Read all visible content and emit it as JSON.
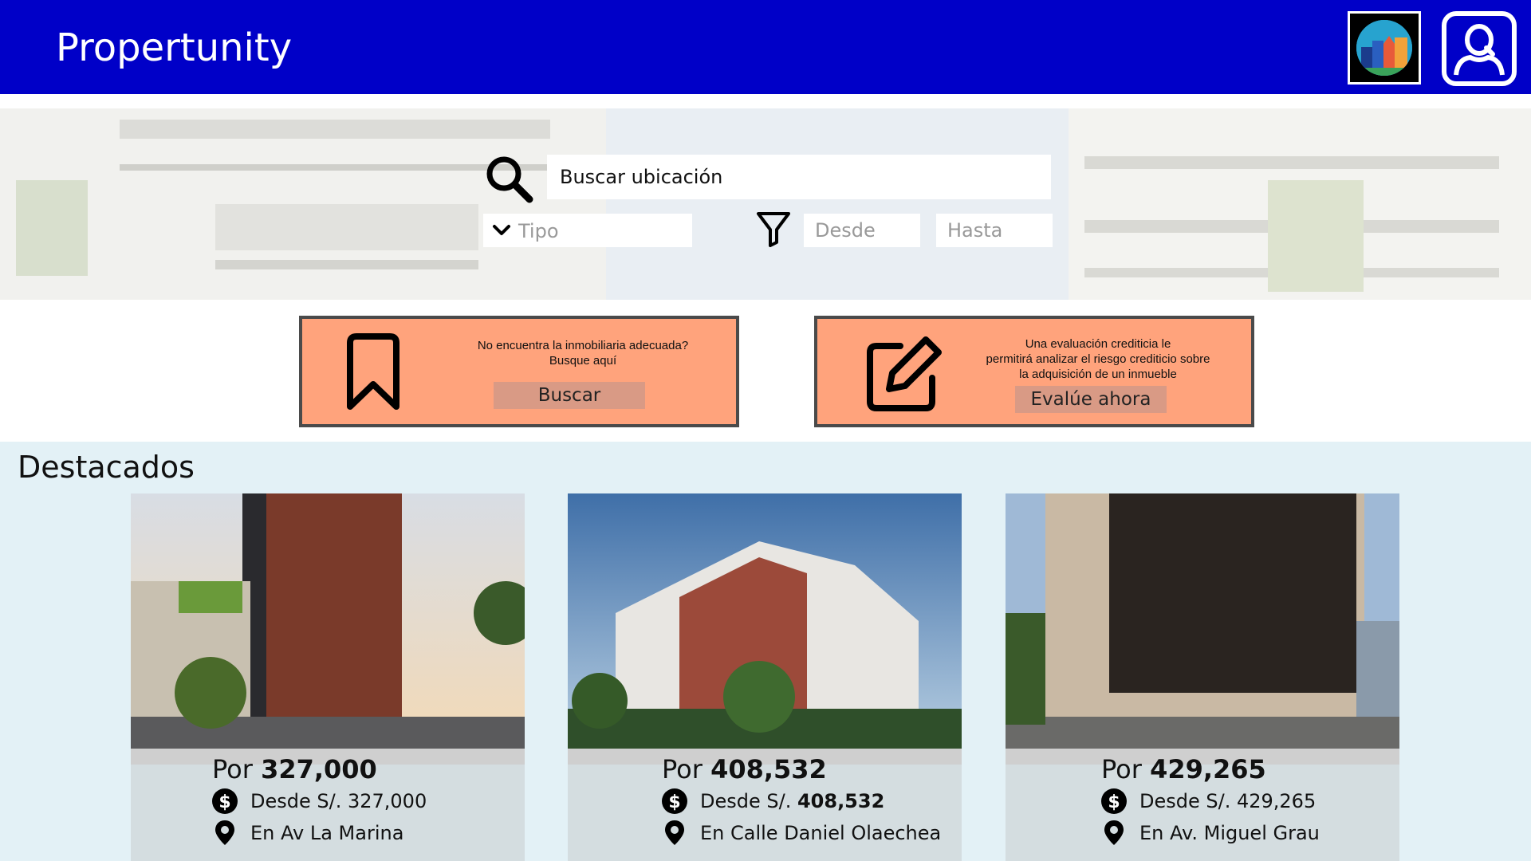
{
  "header": {
    "brand": "Propertunity",
    "logo_icon": "city-logo-icon",
    "user_icon": "user-profile-icon"
  },
  "search": {
    "placeholder": "Buscar ubicación",
    "type_label": "Tipo",
    "from_placeholder": "Desde",
    "to_placeholder": "Hasta"
  },
  "promos": [
    {
      "line1": "No encuentra la inmobiliaria adecuada?",
      "line2": "Busque aquí",
      "button": "Buscar",
      "icon": "bookmark-icon"
    },
    {
      "line1": "Una evaluación crediticia le",
      "line2": "permitirá analizar el riesgo crediticio sobre",
      "line3": "la adquisición de un inmueble",
      "button": "Evalúe ahora",
      "icon": "edit-icon"
    }
  ],
  "featured": {
    "title": "Destacados",
    "cards": [
      {
        "price_prefix": "Por",
        "price": "327,000",
        "from_prefix": "Desde S/.",
        "from_value": "327,000",
        "location": "En Av La Marina"
      },
      {
        "price_prefix": "Por",
        "price": "408,532",
        "from_prefix": "Desde S/.",
        "from_value": "408,532",
        "location": "En Calle Daniel Olaechea"
      },
      {
        "price_prefix": "Por",
        "price": "429,265",
        "from_prefix": "Desde S/.",
        "from_value": "429,265",
        "location": "En Av. Miguel Grau"
      }
    ]
  },
  "colors": {
    "header": "#0000c8",
    "promo": "#ffa37c",
    "promo_button": "#d99a85",
    "featured_bg": "#e3f1f6",
    "card_bg": "#d4dde0"
  }
}
